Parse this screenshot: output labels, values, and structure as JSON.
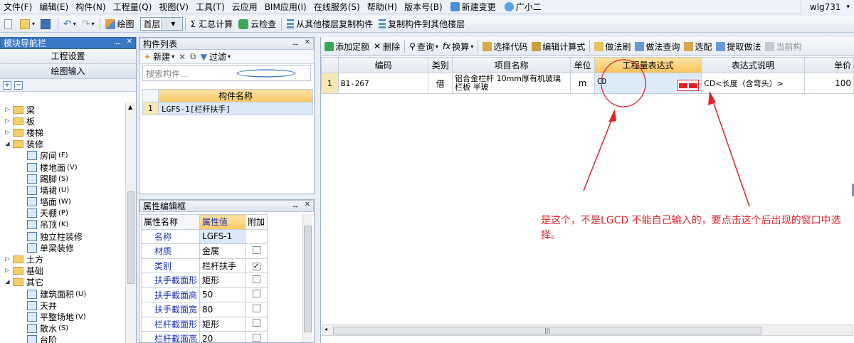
{
  "menu": {
    "items": [
      "文件(F)",
      "编辑(E)",
      "构件(N)",
      "工程量(Q)",
      "视图(V)",
      "工具(T)",
      "云应用",
      "BIM应用(I)",
      "在线服务(S)",
      "帮助(H)",
      "版本号(B)"
    ],
    "new_change": "新建变更",
    "guangxiaoer": "广小二",
    "user": "wlg731"
  },
  "toolbar": {
    "draw": "绘图",
    "floor_value": "首层",
    "sum_calc": "汇总计算",
    "cloud_check": "云检查",
    "copy_from_floor": "从其他楼层复制构件",
    "copy_to_floor": "复制构件到其他楼层"
  },
  "nav": {
    "title": "模块导航栏",
    "btn_project": "工程设置",
    "btn_draw": "绘图输入",
    "tree": [
      {
        "label": "梁",
        "type": "folder",
        "expanded": false,
        "level": 0
      },
      {
        "label": "板",
        "type": "folder",
        "expanded": false,
        "level": 0
      },
      {
        "label": "楼梯",
        "type": "folder",
        "expanded": false,
        "level": 0
      },
      {
        "label": "装修",
        "type": "folder",
        "expanded": true,
        "level": 0
      },
      {
        "label": "房间",
        "shortcut": "(F)",
        "type": "leaf",
        "level": 1
      },
      {
        "label": "楼地面",
        "shortcut": "(V)",
        "type": "leaf",
        "level": 1
      },
      {
        "label": "踢脚",
        "shortcut": "(S)",
        "type": "leaf",
        "level": 1
      },
      {
        "label": "墙裙",
        "shortcut": "(U)",
        "type": "leaf",
        "level": 1
      },
      {
        "label": "墙面",
        "shortcut": "(W)",
        "type": "leaf",
        "level": 1
      },
      {
        "label": "天棚",
        "shortcut": "(P)",
        "type": "leaf",
        "level": 1
      },
      {
        "label": "吊顶",
        "shortcut": "(K)",
        "type": "leaf",
        "level": 1
      },
      {
        "label": "独立柱装修",
        "shortcut": "",
        "type": "leaf",
        "level": 1
      },
      {
        "label": "单梁装修",
        "shortcut": "",
        "type": "leaf",
        "level": 1
      },
      {
        "label": "土方",
        "type": "folder",
        "expanded": false,
        "level": 0
      },
      {
        "label": "基础",
        "type": "folder",
        "expanded": false,
        "level": 0
      },
      {
        "label": "其它",
        "type": "folder",
        "expanded": true,
        "level": 0
      },
      {
        "label": "建筑面积",
        "shortcut": "(U)",
        "type": "leaf",
        "level": 1
      },
      {
        "label": "天井",
        "shortcut": "",
        "type": "leaf",
        "level": 1
      },
      {
        "label": "平整场地",
        "shortcut": "(V)",
        "type": "leaf",
        "level": 1
      },
      {
        "label": "散水",
        "shortcut": "(S)",
        "type": "leaf",
        "level": 1
      },
      {
        "label": "台阶",
        "shortcut": "",
        "type": "leaf",
        "level": 1
      }
    ]
  },
  "component_list": {
    "title": "构件列表",
    "new_label": "新建",
    "filter_label": "过滤",
    "search_placeholder": "搜索构件...",
    "column_header": "构件名称",
    "rows": [
      {
        "num": "1",
        "name": "LGFS-1[栏杆扶手]"
      }
    ]
  },
  "properties": {
    "title": "属性编辑框",
    "headers": [
      "属性名称",
      "属性值",
      "附加"
    ],
    "rows": [
      {
        "name": "名称",
        "value": "LGFS-1",
        "checkbox": false,
        "checked": false
      },
      {
        "name": "材质",
        "value": "金属",
        "checkbox": true,
        "checked": false
      },
      {
        "name": "类别",
        "value": "栏杆扶手",
        "checkbox": true,
        "checked": true
      },
      {
        "name": "扶手截面形",
        "value": "矩形",
        "checkbox": true,
        "checked": false
      },
      {
        "name": "扶手截面高",
        "value": "50",
        "checkbox": true,
        "checked": false
      },
      {
        "name": "扶手截面宽",
        "value": "80",
        "checkbox": true,
        "checked": false
      },
      {
        "name": "栏杆截面形",
        "value": "矩形",
        "checkbox": true,
        "checked": false
      },
      {
        "name": "栏杆截面高",
        "value": "20",
        "checkbox": true,
        "checked": false
      }
    ]
  },
  "main_toolbar": {
    "add_quota": "添加定额",
    "delete": "删除",
    "query": "查询",
    "replace": "换算",
    "select_code": "选择代码",
    "edit_formula": "编辑计算式",
    "method_brush": "做法刷",
    "method_query": "做法查询",
    "pick": "选配",
    "extract_method": "提取做法",
    "current": "当前构"
  },
  "grid": {
    "headers": [
      "编码",
      "类别",
      "项目名称",
      "单位",
      "工程量表达式",
      "表达式说明",
      "单价"
    ],
    "rows": [
      {
        "num": "1",
        "code": "B1-267",
        "category": "借",
        "name": "铝合金栏杆 10mm厚有机玻璃栏板 半玻",
        "unit": "m",
        "expr": "CD",
        "expr_desc": "CD<长度（含弯头）>",
        "price": "100"
      }
    ]
  },
  "annotation": {
    "text": "是这个，不是LGCD 不能自己输入的，要点击这个后出现的窗口中选择。",
    "color": "#e0242b"
  }
}
